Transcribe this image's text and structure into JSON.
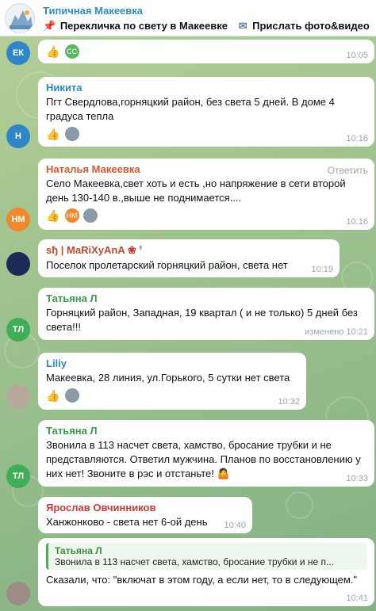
{
  "header": {
    "channel_title": "Типичная Макеевка",
    "pinned_1": "Перекличка по свету в Макеевке",
    "pinned_2": "Прислать фото&видео"
  },
  "messages": [
    {
      "id": "m1",
      "avatar": "ЕК",
      "avatar_color": "#2e86c9",
      "time": "10:05"
    },
    {
      "id": "m2",
      "avatar": "Н",
      "avatar_color": "#2e86c9",
      "sender": "Никита",
      "sender_color": "#2e86c9",
      "text": "Пгт Свердлова,горняцкий район, без света 5 дней. В доме 4 градуса тепла",
      "time": "10:16"
    },
    {
      "id": "m3",
      "avatar": "НМ",
      "avatar_color": "#f0892d",
      "sender": "Наталья Макеевка",
      "sender_color": "#d4582b",
      "reply_label": "Ответить",
      "text": "Село Макеевка,свет хоть и есть ,но напряжение в сети второй день 130-140 в.,выше не поднимается....",
      "time": "10:16"
    },
    {
      "id": "m4",
      "sender": "ѕђ | MaRiXyAnA",
      "sender_color": "#c04a2a",
      "text": "Поселок пролетарский горняцкий район, света нет",
      "time": "10:19"
    },
    {
      "id": "m5",
      "avatar": "ТЛ",
      "avatar_color": "#3fae58",
      "sender": "Татьяна Л",
      "sender_color": "#3a9a4a",
      "text": "Горняцкий район, Западная, 19 квартал ( и не только) 5 дней без света!!!",
      "edited": "изменено",
      "time": "10:21"
    },
    {
      "id": "m6",
      "sender": "Liliy",
      "sender_color": "#2e86c9",
      "text": "Макеевка,  28 линия, ул.Горького, 5 сутки нет света",
      "time": "10:32"
    },
    {
      "id": "m7",
      "avatar": "ТЛ",
      "avatar_color": "#3fae58",
      "sender": "Татьяна Л",
      "sender_color": "#3a9a4a",
      "text": "Звонила в 113 насчет света, хамство, бросание трубки и не представляются. Ответил мужчина. Планов по восстановлению у них нет! Звоните в рэс и отстаньте!",
      "time": "10:33"
    },
    {
      "id": "m8",
      "sender": "Ярослав Овчинников",
      "sender_color": "#c83a3a",
      "text": "Ханжонково - света нет 6-ой день",
      "time": "10:40"
    },
    {
      "id": "m9",
      "quote_author": "Татьяна Л",
      "quote_text": "Звонила в 113 насчет света, хамство, бросание трубки и не п...",
      "text": "Сказали, что: \"включат в этом году, а если нет, то в следующем.\"",
      "time": "10:41"
    }
  ],
  "reaction_chips": {
    "cc": "CC",
    "hm": "НМ"
  },
  "colors": {
    "header_title": "#2f8bc4",
    "bubble": "#ffffff",
    "time": "#9aa4ad"
  }
}
